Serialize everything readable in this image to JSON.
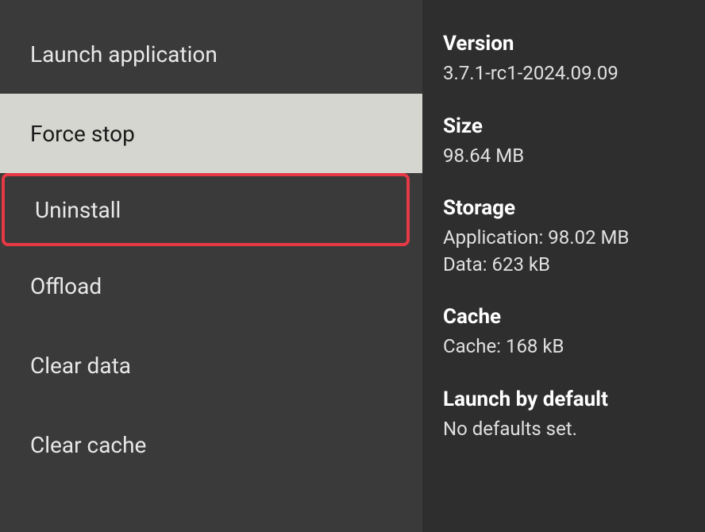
{
  "menu": {
    "items": [
      {
        "label": "Launch application"
      },
      {
        "label": "Force stop"
      },
      {
        "label": "Uninstall"
      },
      {
        "label": "Offload"
      },
      {
        "label": "Clear data"
      },
      {
        "label": "Clear cache"
      }
    ]
  },
  "info": {
    "version_label": "Version",
    "version_value": "3.7.1-rc1-2024.09.09",
    "size_label": "Size",
    "size_value": "98.64 MB",
    "storage_label": "Storage",
    "storage_app": "Application: 98.02 MB",
    "storage_data": "Data: 623 kB",
    "cache_label": "Cache",
    "cache_value": "Cache: 168 kB",
    "launch_label": "Launch by default",
    "launch_value": "No defaults set."
  }
}
